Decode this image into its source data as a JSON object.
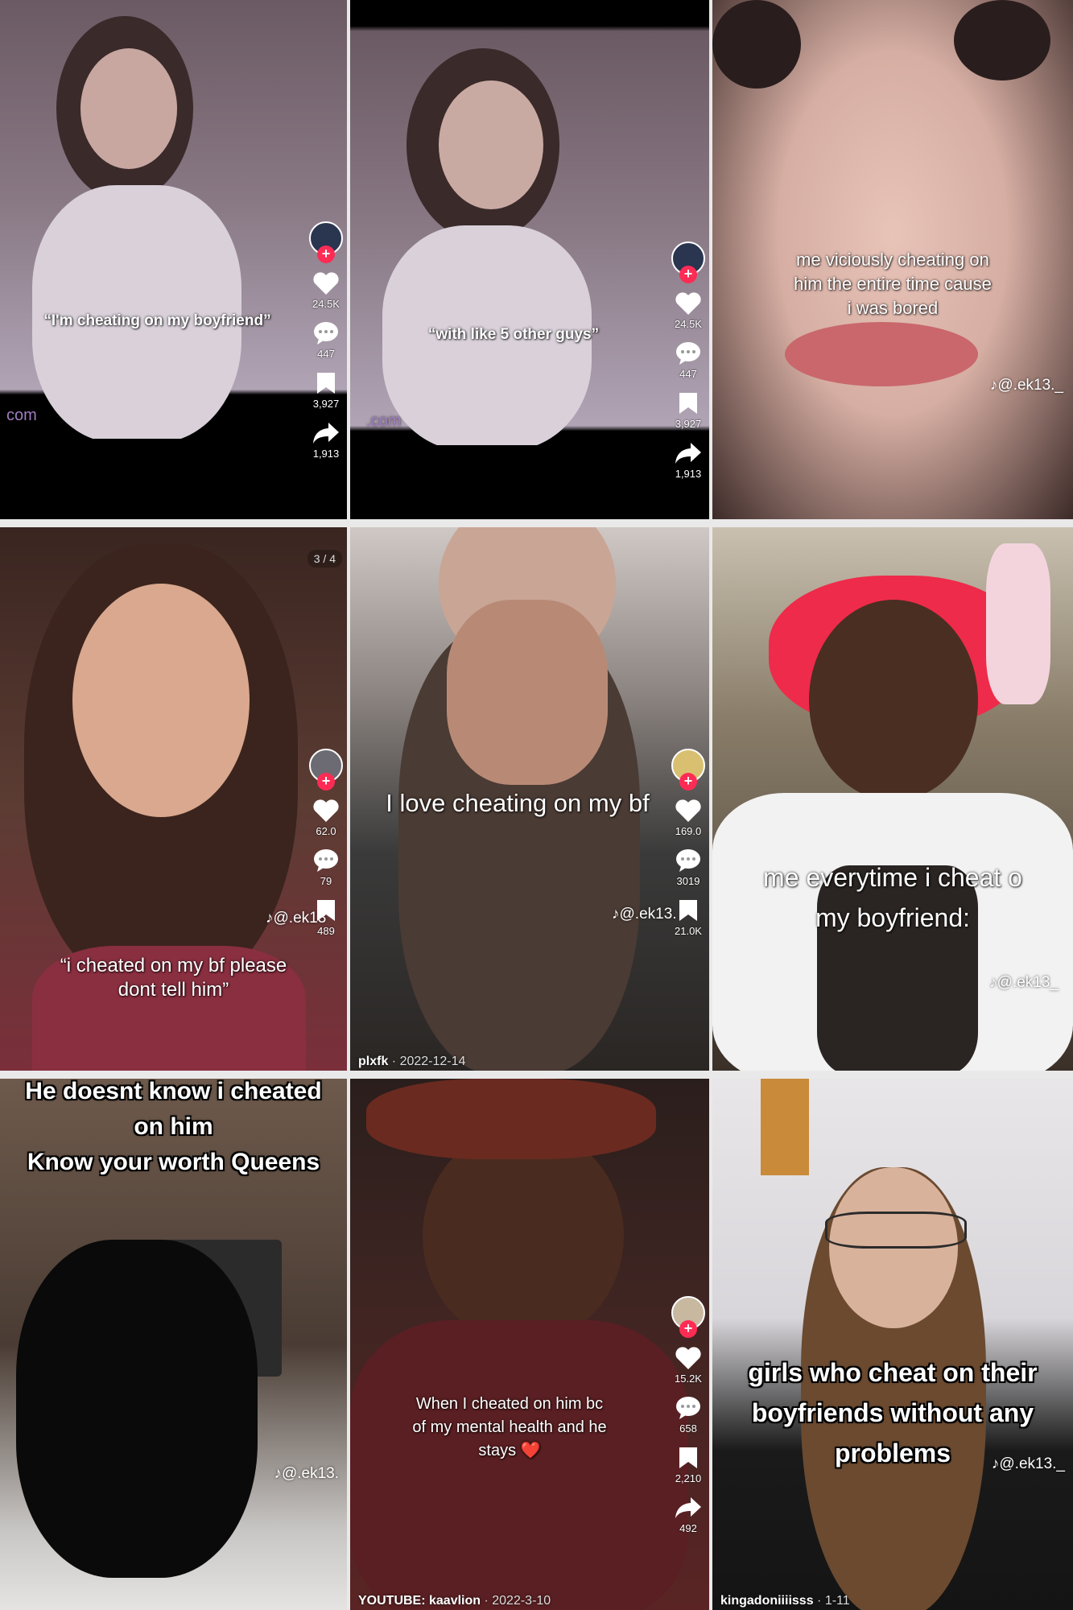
{
  "tiles": [
    {
      "caption": "“I'm cheating on my boyfriend”",
      "rail": {
        "likes": "24.5K",
        "comments": "447",
        "saves": "3,927",
        "shares": "1,913"
      },
      "watermark": "com"
    },
    {
      "caption": "“with like 5 other guys”",
      "rail": {
        "likes": "24.5K",
        "comments": "447",
        "saves": "3,927",
        "shares": "1,913"
      },
      "watermark": ".com"
    },
    {
      "caption": "me viciously cheating on\nhim the entire time cause\ni was bored",
      "handle": "♪@.ek13._"
    },
    {
      "caption": "“i cheated on my bf please\ndont tell him”",
      "handle": "♪@.ek13",
      "counter": "3 / 4",
      "rail": {
        "likes": "62.0",
        "comments": "79",
        "saves": "489"
      }
    },
    {
      "caption": "I love cheating on my bf",
      "handle": "♪@.ek13.",
      "rail": {
        "likes": "169.0",
        "comments": "3019",
        "saves": "21.0K"
      },
      "footer": {
        "author": "plxfk",
        "date": "· 2022-12-14"
      }
    },
    {
      "caption": "me everytime i cheat o\nmy boyfriend:",
      "handle": "♪@.ek13_"
    },
    {
      "caption": "He doesnt know i cheated\non him\nKnow your worth Queens",
      "handle": "♪@.ek13."
    },
    {
      "caption": "When I cheated on him bc\nof my mental health and he\nstays ❤️",
      "rail": {
        "likes": "15.2K",
        "comments": "658",
        "saves": "2,210",
        "shares": "492"
      },
      "footer": {
        "author": "YOUTUBE: kaavlion",
        "date": "· 2022-3-10"
      }
    },
    {
      "caption": "girls who cheat on their\nboyfriends without any\nproblems",
      "handle": "♪@.ek13._",
      "footer": {
        "author": "kingadoniiiisss",
        "date": "· 1-11"
      }
    }
  ]
}
